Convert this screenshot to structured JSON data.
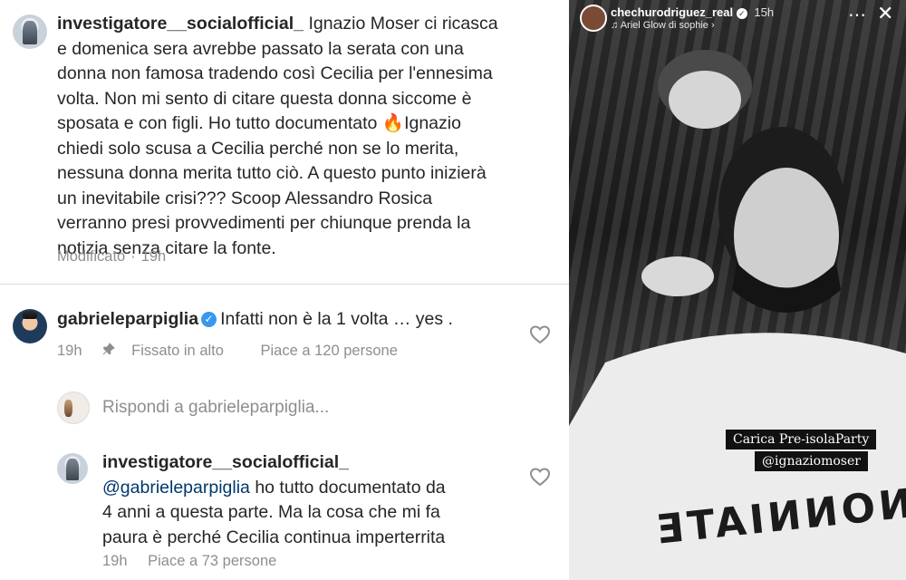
{
  "comments": {
    "main": {
      "username": "investigatore__socialofficial_",
      "lines": [
        "Ignazio Moser ci ricasca",
        "e domenica sera avrebbe passato la serata con una",
        "donna non famosa tradendo così Cecilia per l'ennesima",
        "volta. Non mi sento di citare questa donna siccome è",
        "sposata e con figli. Ho tutto documentato 🔥Ignazio",
        "chiedi solo scusa a Cecilia perché non se lo merita,",
        "nessuna donna merita tutto ciò. A questo punto inizierà",
        "un inevitabile crisi??? Scoop Alessandro Rosica",
        "verranno presi provvedimenti per chiunque prenda la",
        "notizia senza citare la fonte."
      ],
      "edited": "Modificato",
      "sep": "·",
      "time": "19h"
    },
    "reply1": {
      "username": "gabrieleparpiglia",
      "verified": "✓",
      "text": "Infatti non è la 1 volta … yes .",
      "time": "19h",
      "pinned": "Fissato in alto",
      "likes": "Piace a 120 persone"
    },
    "reply_prompt": "Rispondi a gabrieleparpiglia...",
    "reply2": {
      "username": "investigatore__socialofficial_",
      "mention": "@gabrieleparpiglia",
      "lines": [
        "ho tutto documentato da",
        "4 anni a questa parte. Ma la cosa che mi fa",
        "paura è perché Cecilia continua imperterrita"
      ],
      "time": "19h",
      "likes": "Piace a 73 persone"
    }
  },
  "story": {
    "username": "chechurodriguez_real",
    "verified": "✓",
    "time": "15h",
    "music": "♫ Ariel Glow di sophie ›",
    "sticker_1": "Carica Pre-isolaParty",
    "sticker_2": "@ignaziomoser",
    "shirt_text": "CHINNONNIATE"
  },
  "colors": {
    "text": "#262626",
    "meta": "#8e8e8e",
    "link": "#00376b",
    "verified": "#3897f0"
  },
  "icons": [
    "heart-icon",
    "pin-icon",
    "verified-icon",
    "more-icon",
    "close-icon",
    "music-icon"
  ]
}
